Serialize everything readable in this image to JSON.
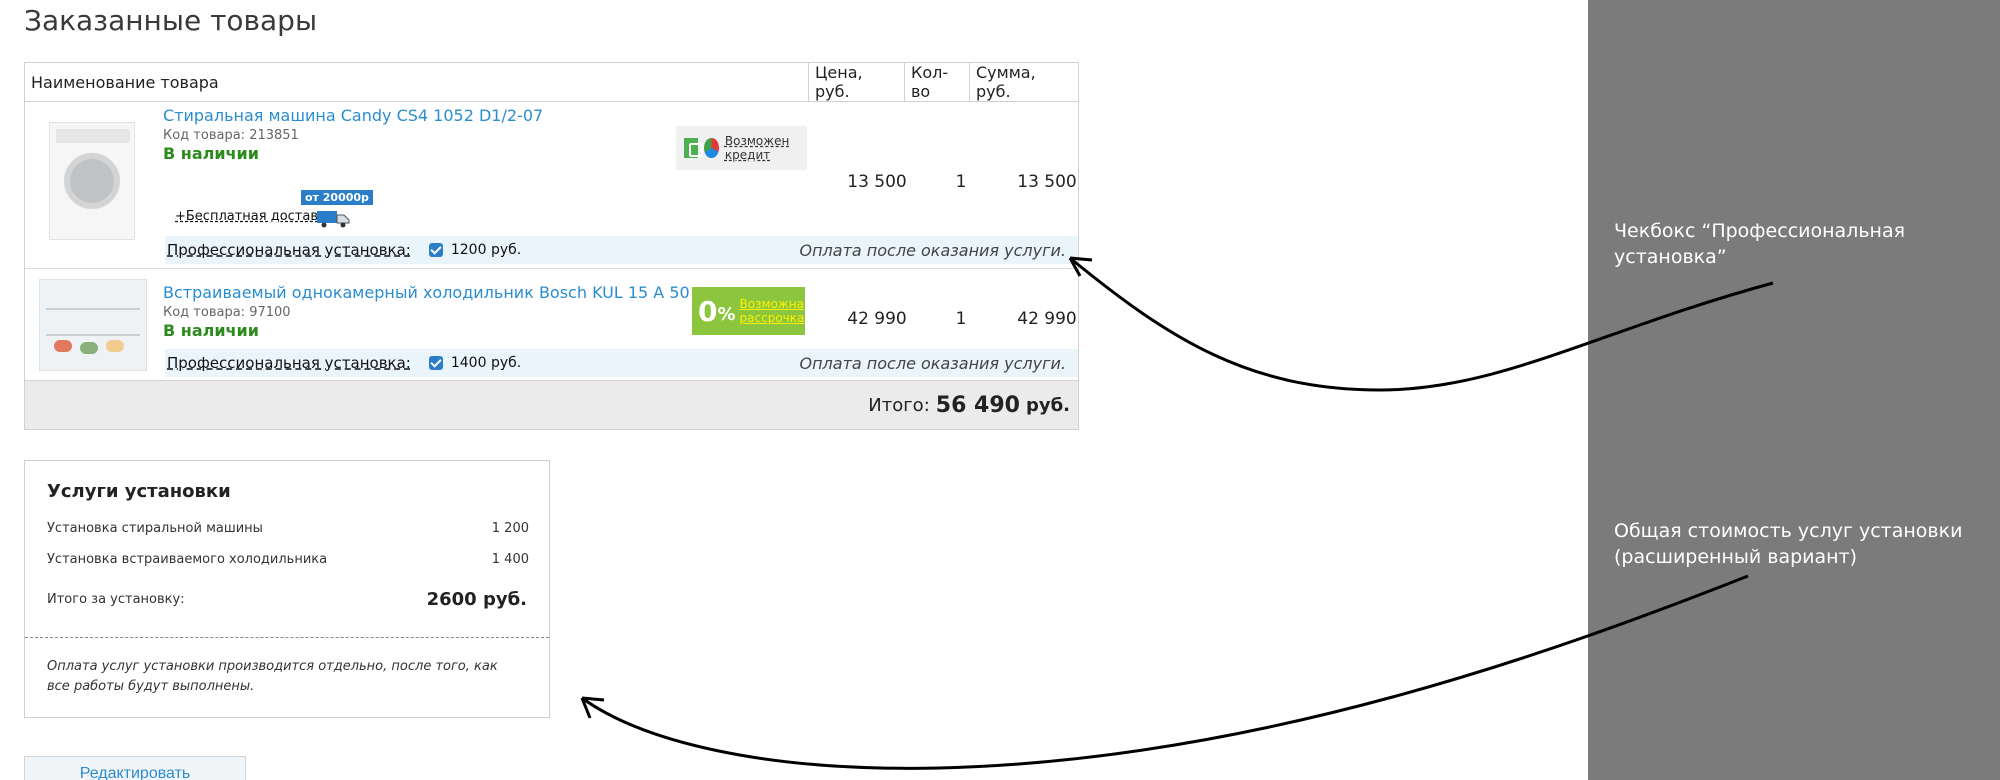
{
  "page": {
    "title": "Заказанные товары"
  },
  "table": {
    "headers": {
      "name": "Наименование товара",
      "price": "Цена, руб.",
      "qty": "Кол-во",
      "sum": "Сумма, руб."
    },
    "rows": [
      {
        "name": "Стиральная машина Candy CS4 1052 D1/2-07",
        "code": "Код товара: 213851",
        "stock": "В наличии",
        "credit_label": "Возможен кредит",
        "delivery_label": "+Бесплатная доставка",
        "delivery_badge": "от 20000р",
        "price": "13 500",
        "qty": "1",
        "sum": "13 500",
        "install_label": "Профессиональная установка:",
        "install_checked": true,
        "install_price": "1200 руб.",
        "pay_note": "Оплата после оказания услуги."
      },
      {
        "name": "Встраиваемый однокамерный холодильник Bosch KUL 15 A 50",
        "code": "Код товара: 97100",
        "stock": "В наличии",
        "promo_zero": "0",
        "promo_pct": "%",
        "promo_text": "Возможна рассрочка",
        "price": "42 990",
        "qty": "1",
        "sum": "42 990",
        "install_label": "Профессиональная установка:",
        "install_checked": true,
        "install_price": "1400 руб.",
        "pay_note": "Оплата после оказания услуги."
      }
    ],
    "total_label": "Итого:",
    "total_value": "56 490",
    "total_currency": "руб."
  },
  "services": {
    "title": "Услуги установки",
    "items": [
      {
        "label": "Установка стиральной машины",
        "value": "1 200"
      },
      {
        "label": "Установка встраиваемого холодильника",
        "value": "1 400"
      }
    ],
    "total_label": "Итого за установку:",
    "total_value": "2600 руб.",
    "note": "Оплата услуг установки производится отдельно, после того, как все работы будут выполнены."
  },
  "edit_button": "Редактировать",
  "annotations": [
    "Чекбокс “Профессиональная установка”",
    "Общая стоимость услуг установки (расширенный вариант)"
  ],
  "colors": {
    "link": "#2a8dd0",
    "in_stock": "#2d8b1e",
    "checkbox": "#2a7dc8",
    "promo_green": "#8cc63f",
    "side_panel": "#7b7b7b"
  }
}
